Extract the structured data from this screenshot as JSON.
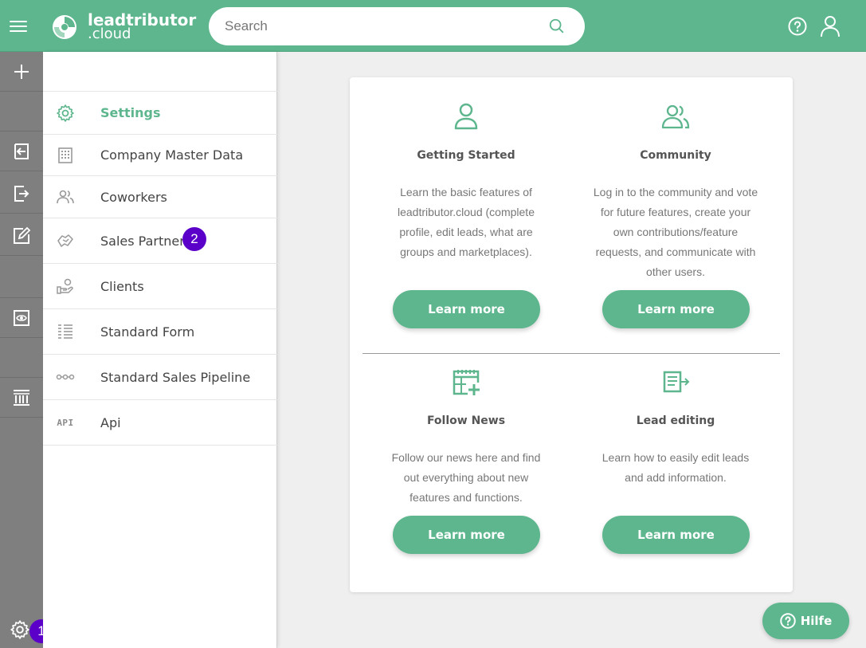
{
  "header": {
    "logo_main": "leadtributor",
    "logo_sub": ".cloud",
    "search_placeholder": "Search"
  },
  "rail": {
    "items": [
      "add-icon",
      "sign-in-icon",
      "sign-out-icon",
      "edit-icon",
      "eye-icon",
      "columns-icon"
    ],
    "settings_badge": "1"
  },
  "sidebar": {
    "items": [
      {
        "label": "Settings",
        "icon": "gear-icon",
        "active": true
      },
      {
        "label": "Company Master Data",
        "icon": "building-icon"
      },
      {
        "label": "Coworkers",
        "icon": "users-icon"
      },
      {
        "label": "Sales Partners",
        "icon": "handshake-icon",
        "badge": "2"
      },
      {
        "label": "Clients",
        "icon": "client-icon"
      },
      {
        "label": "Standard Form",
        "icon": "form-icon"
      },
      {
        "label": "Standard Sales Pipeline",
        "icon": "pipeline-icon"
      },
      {
        "label": "Api",
        "icon": "api-icon",
        "icon_text": "API"
      }
    ]
  },
  "tiles": [
    {
      "title": "Getting Started",
      "text": "Learn the basic features of leadtributor.cloud (complete profile, edit leads, what are groups and marketplaces).",
      "button": "Learn more",
      "icon": "user-icon"
    },
    {
      "title": "Community",
      "text": "Log in to the community and vote for future features, create your own contributions/feature requests, and communicate with other users.",
      "button": "Learn more",
      "icon": "users-icon"
    },
    {
      "title": "Follow News",
      "text": "Follow our news here and find out everything about new features and functions.",
      "button": "Learn more",
      "icon": "calendar-add-icon"
    },
    {
      "title": "Lead editing",
      "text": "Learn how to easily edit leads and add information.",
      "button": "Learn more",
      "icon": "document-arrow-icon"
    }
  ],
  "help_button": "Hilfe",
  "colors": {
    "brand": "#5db68d",
    "badge": "#5b00c8",
    "rail": "#7f7f7f"
  }
}
